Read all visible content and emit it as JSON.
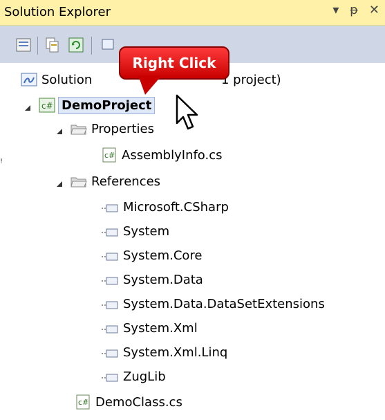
{
  "window": {
    "title": "Solution Explorer"
  },
  "controls": {
    "dropdown": "▾",
    "pin": "ᵽ",
    "close": "✕"
  },
  "tree": {
    "solution_label": "Solution",
    "solution_suffix": "1 project)",
    "project": "DemoProject",
    "properties": "Properties",
    "assemblyinfo": "AssemblyInfo.cs",
    "references": "References",
    "refs": [
      "Microsoft.CSharp",
      "System",
      "System.Core",
      "System.Data",
      "System.Data.DataSetExtensions",
      "System.Xml",
      "System.Xml.Linq",
      "ZugLib"
    ],
    "democlass": "DemoClass.cs"
  },
  "callout": {
    "text": "Right Click"
  },
  "edge_char": "ꜝ",
  "colors": {
    "titlebar": "#fff2a8",
    "toolbar": "#cfd6e5",
    "callout": "#d40000"
  }
}
